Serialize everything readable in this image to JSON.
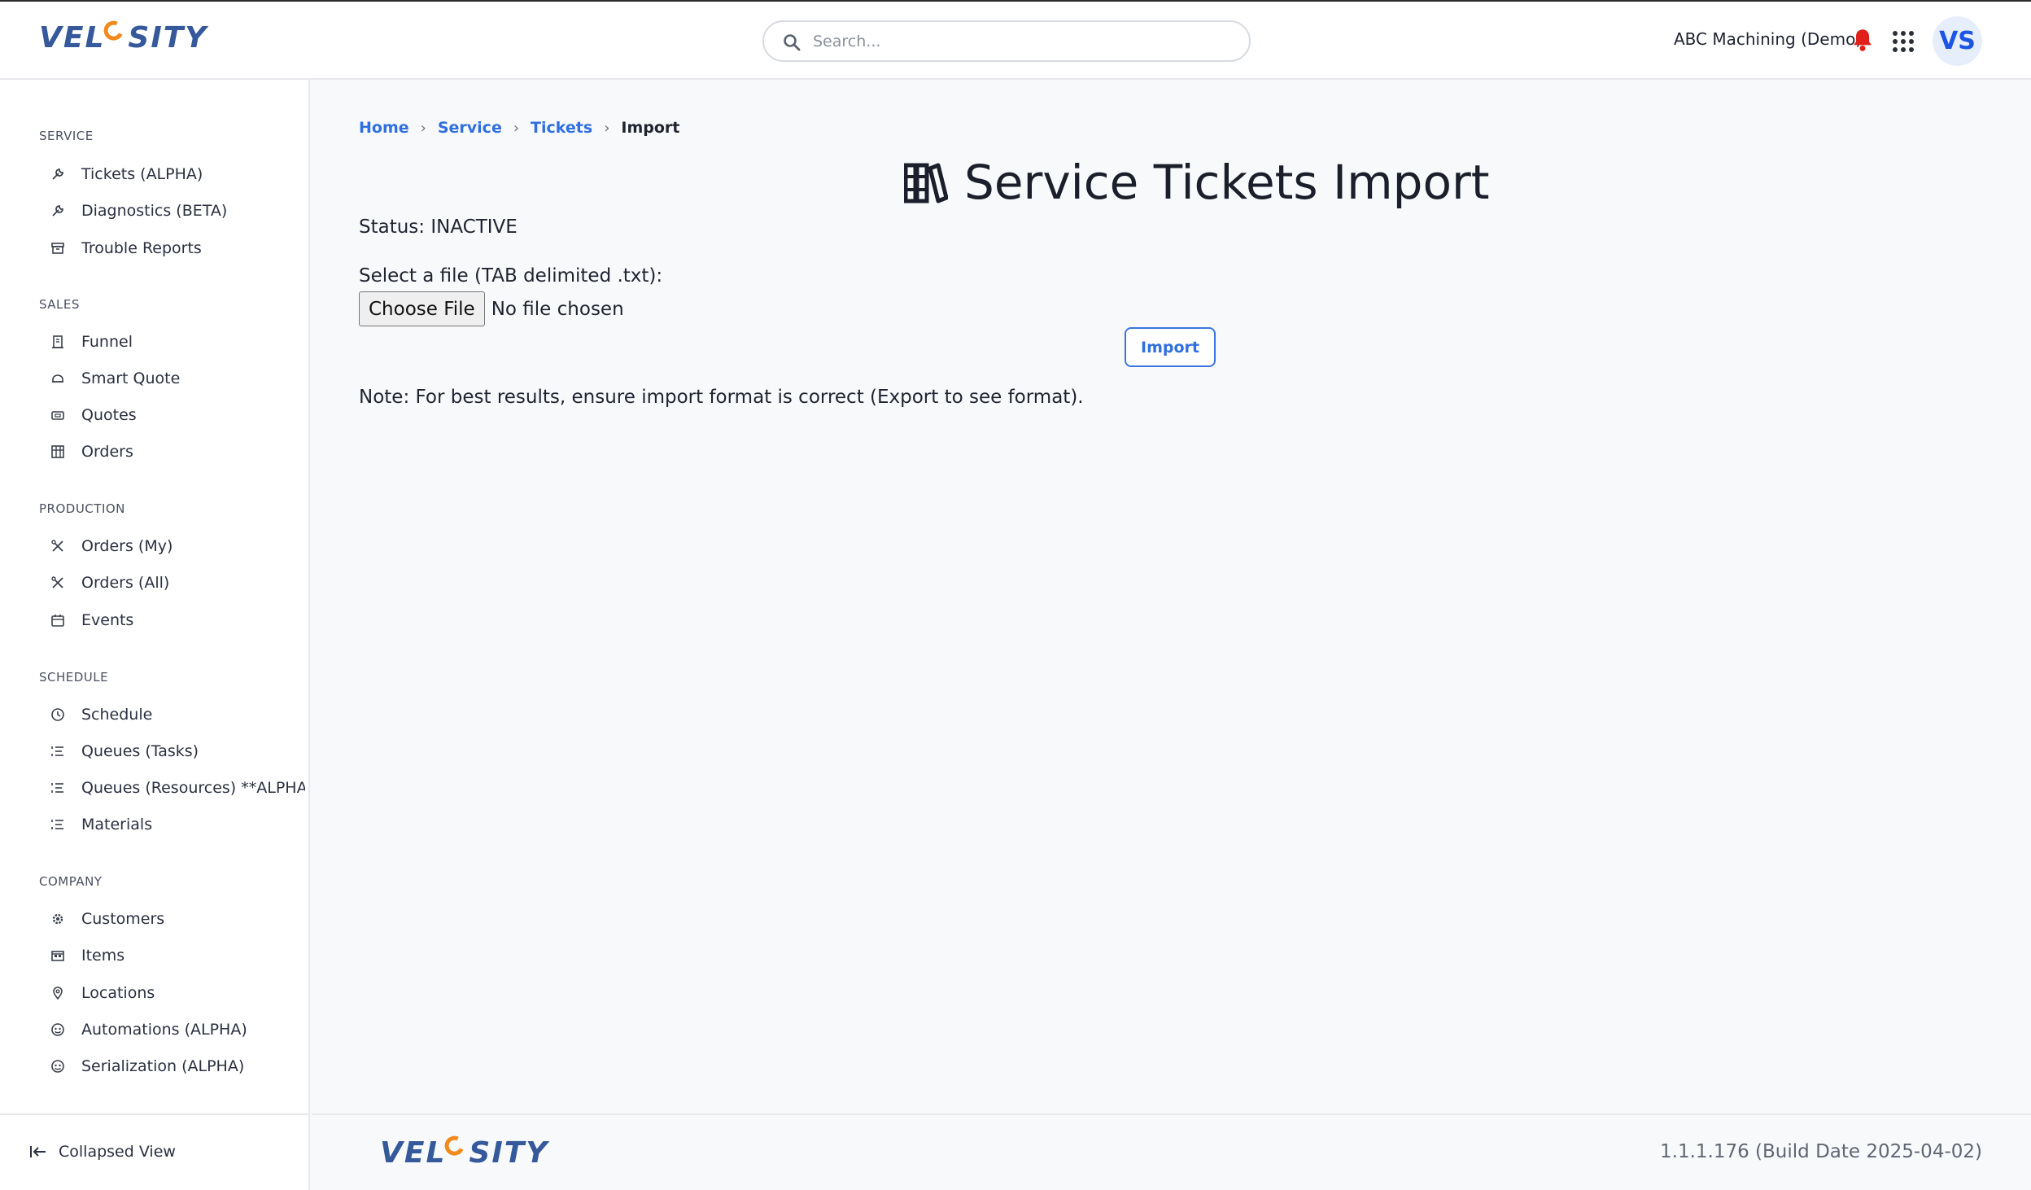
{
  "header": {
    "logo_left": "VEL",
    "logo_right": "SITY",
    "search_placeholder": "Search...",
    "company": "ABC Machining (Demo)",
    "avatar_initials": "VS",
    "bell_color": "#e0201b"
  },
  "sidebar": {
    "sections": [
      {
        "title": "SERVICE",
        "items": [
          {
            "label": "Tickets (ALPHA)",
            "icon": "wrench-icon"
          },
          {
            "label": "Diagnostics (BETA)",
            "icon": "wrench-icon"
          },
          {
            "label": "Trouble Reports",
            "icon": "archive-icon"
          }
        ]
      },
      {
        "title": "SALES",
        "items": [
          {
            "label": "Funnel",
            "icon": "building-icon"
          },
          {
            "label": "Smart Quote",
            "icon": "hat-icon"
          },
          {
            "label": "Quotes",
            "icon": "ticket-icon"
          },
          {
            "label": "Orders",
            "icon": "grid-icon"
          }
        ]
      },
      {
        "title": "PRODUCTION",
        "items": [
          {
            "label": "Orders (My)",
            "icon": "tools-icon"
          },
          {
            "label": "Orders (All)",
            "icon": "tools-icon"
          },
          {
            "label": "Events",
            "icon": "calendar-icon"
          }
        ]
      },
      {
        "title": "SCHEDULE",
        "items": [
          {
            "label": "Schedule",
            "icon": "clock-icon"
          },
          {
            "label": "Queues (Tasks)",
            "icon": "list-icon"
          },
          {
            "label": "Queues (Resources) **ALPHA**",
            "icon": "list-icon"
          },
          {
            "label": "Materials",
            "icon": "list-icon"
          }
        ]
      },
      {
        "title": "COMPANY",
        "items": [
          {
            "label": "Customers",
            "icon": "gear-icon"
          },
          {
            "label": "Items",
            "icon": "warehouse-icon"
          },
          {
            "label": "Locations",
            "icon": "pin-icon"
          },
          {
            "label": "Automations (ALPHA)",
            "icon": "robot-icon"
          },
          {
            "label": "Serialization (ALPHA)",
            "icon": "robot-icon"
          }
        ]
      }
    ],
    "collapsed_label": "Collapsed View"
  },
  "main": {
    "breadcrumb": [
      "Home",
      "Service",
      "Tickets",
      "Import"
    ],
    "title": "Service Tickets Import",
    "status": "Status: INACTIVE",
    "file_label": "Select a file (TAB delimited .txt):",
    "choose_file": "Choose File",
    "no_file": "No file chosen",
    "import_button": "Import",
    "note": "Note: For best results, ensure import format is correct (Export to see format)."
  },
  "footer": {
    "version": "1.1.1.176 (Build Date 2025-04-02)"
  }
}
